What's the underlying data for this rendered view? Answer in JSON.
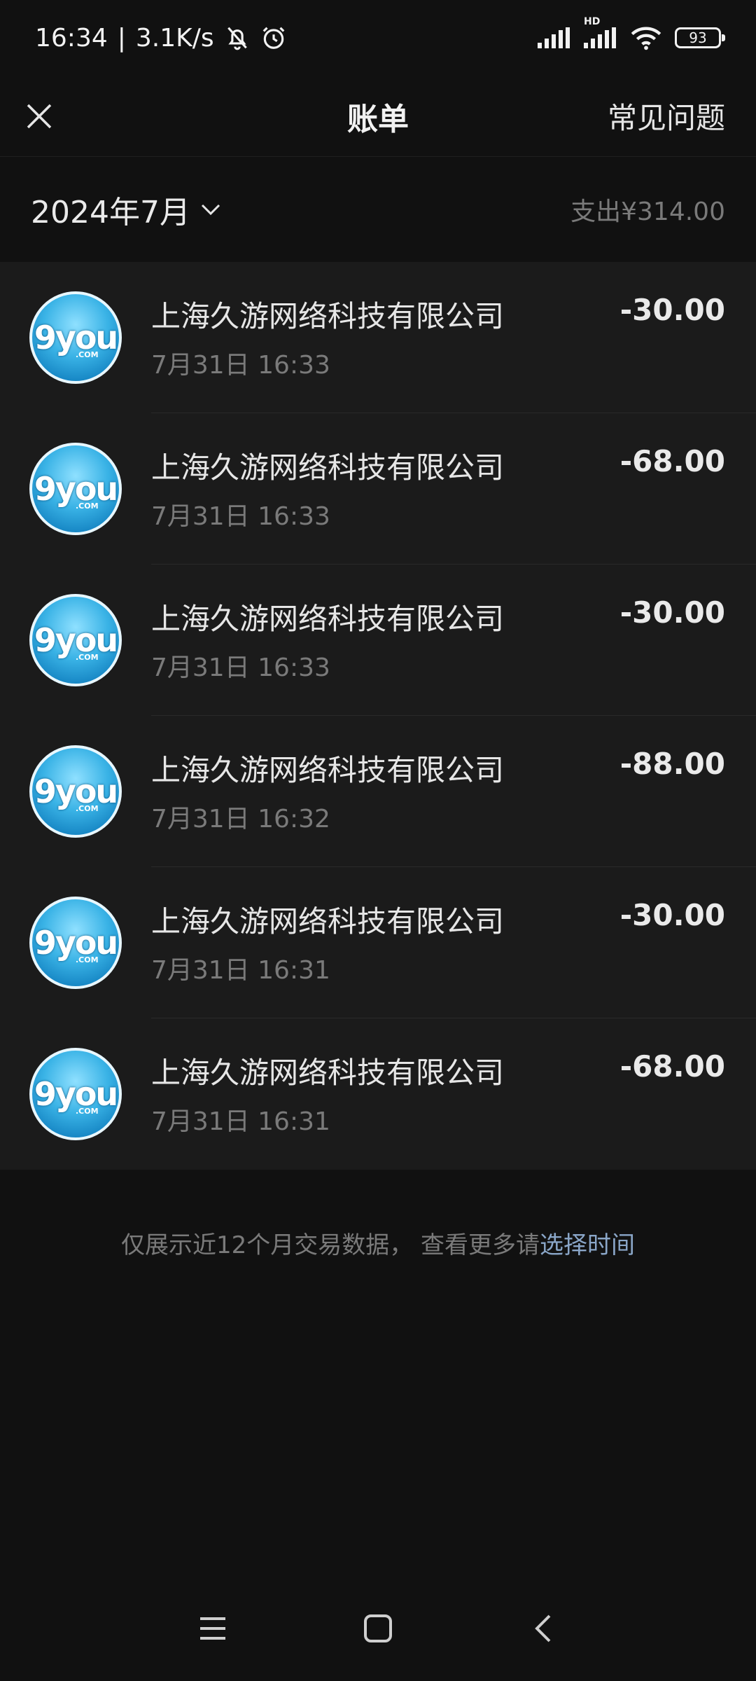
{
  "status": {
    "time": "16:34",
    "separator": "|",
    "speed": "3.1K/s",
    "battery": "93",
    "hd": "HD"
  },
  "header": {
    "title": "账单",
    "faq": "常见问题"
  },
  "month": {
    "label": "2024年7月",
    "expense": "支出¥314.00"
  },
  "transactions": [
    {
      "merchant": "上海久游网络科技有限公司",
      "time": "7月31日 16:33",
      "amount": "-30.00"
    },
    {
      "merchant": "上海久游网络科技有限公司",
      "time": "7月31日 16:33",
      "amount": "-68.00"
    },
    {
      "merchant": "上海久游网络科技有限公司",
      "time": "7月31日 16:33",
      "amount": "-30.00"
    },
    {
      "merchant": "上海久游网络科技有限公司",
      "time": "7月31日 16:32",
      "amount": "-88.00"
    },
    {
      "merchant": "上海久游网络科技有限公司",
      "time": "7月31日 16:31",
      "amount": "-30.00"
    },
    {
      "merchant": "上海久游网络科技有限公司",
      "time": "7月31日 16:31",
      "amount": "-68.00"
    }
  ],
  "logo": {
    "text": "9you",
    "sub": ".COM"
  },
  "footer": {
    "note": "仅展示近12个月交易数据， 查看更多请",
    "link": "选择时间"
  },
  "icons": {
    "close": "close-icon",
    "chevron": "chevron-down-icon",
    "menu": "menu-icon",
    "home": "home-icon",
    "back": "back-icon"
  }
}
